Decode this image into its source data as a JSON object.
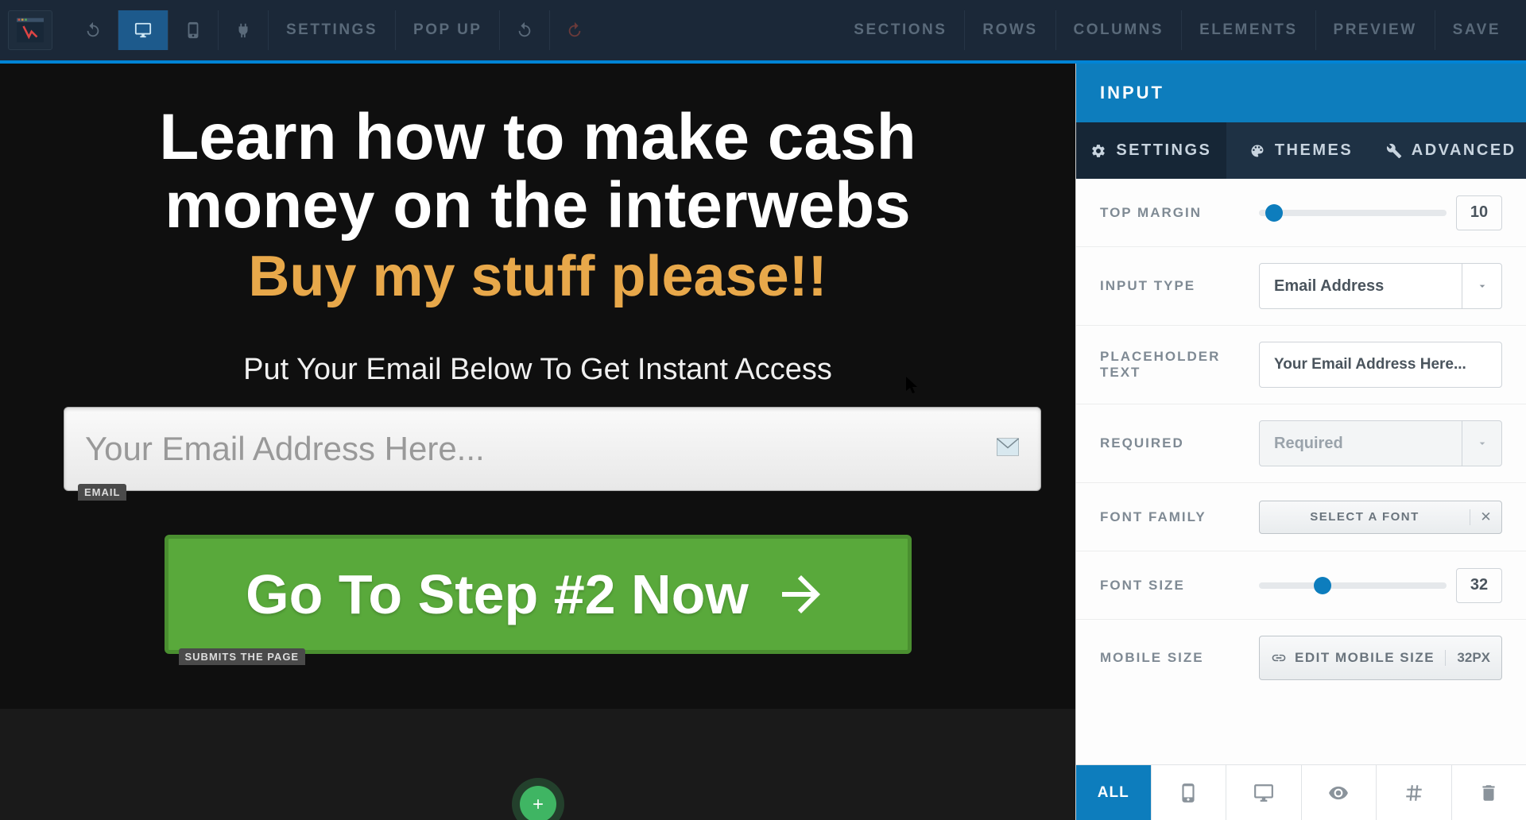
{
  "toolbar": {
    "settings": "SETTINGS",
    "popup": "POP UP",
    "sections": "SECTIONS",
    "rows": "ROWS",
    "columns": "COLUMNS",
    "elements": "ELEMENTS",
    "preview": "PREVIEW",
    "save": "SAVE"
  },
  "canvas": {
    "headline": "Learn how to make cash money on the interwebs",
    "subhead": "Buy my stuff please!!",
    "instruction": "Put Your Email Below To Get Instant Access",
    "emailPlaceholder": "Your Email Address Here...",
    "emailBadge": "EMAIL",
    "ctaLabel": "Go To Step #2 Now",
    "ctaBadge": "SUBMITS THE PAGE"
  },
  "panel": {
    "title": "INPUT",
    "tabs": {
      "settings": "SETTINGS",
      "themes": "THEMES",
      "advanced": "ADVANCED"
    },
    "settings": {
      "topMargin": {
        "label": "TOP MARGIN",
        "value": "10"
      },
      "inputType": {
        "label": "INPUT TYPE",
        "value": "Email Address"
      },
      "placeholderText": {
        "label": "PLACEHOLDER TEXT",
        "value": "Your Email Address Here..."
      },
      "required": {
        "label": "REQUIRED",
        "value": "Required"
      },
      "fontFamily": {
        "label": "FONT FAMILY",
        "button": "SELECT A FONT"
      },
      "fontSize": {
        "label": "FONT SIZE",
        "value": "32"
      },
      "mobileSize": {
        "label": "MOBILE SIZE",
        "button": "EDIT MOBILE SIZE",
        "value": "32PX"
      }
    },
    "footer": {
      "all": "ALL"
    }
  }
}
